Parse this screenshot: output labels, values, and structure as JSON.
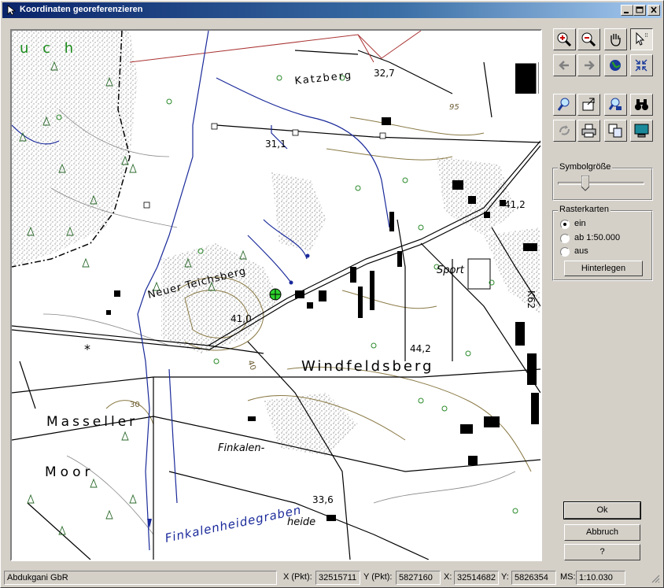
{
  "window": {
    "title": "Koordinaten georeferenzieren"
  },
  "map": {
    "labels": {
      "katzberg": "Katzberg",
      "elev_327": "32,7",
      "elev_311": "31,1",
      "elev_412": "41,2",
      "neuer_teichsberg": "Neuer Teichsberg",
      "elev_410": "41,0",
      "sport": "Sport",
      "elev_442": "44,2",
      "windfeldsberg": "Windfeldsberg",
      "masseller": "Masseller",
      "moor": "Moor",
      "finkalen": "Finkalen-",
      "heide": "heide",
      "elev_336": "33,6",
      "finkalenheidegraben": "Finkalenheidegraben",
      "road_k62": "K62",
      "uch": "u c h",
      "contour_95": "95",
      "contour_30": "30",
      "contour_40": "40"
    }
  },
  "toolbar": {
    "tools": [
      {
        "icon": "zoom-in-icon"
      },
      {
        "icon": "zoom-out-icon"
      },
      {
        "icon": "pan-hand-icon"
      },
      {
        "icon": "pointer-select-icon"
      },
      {
        "icon": "back-arrow-icon"
      },
      {
        "icon": "forward-arrow-icon"
      },
      {
        "icon": "globe-icon"
      },
      {
        "icon": "fit-extent-icon"
      },
      {
        "icon": "zoom-search-icon"
      },
      {
        "icon": "open-map-icon"
      },
      {
        "icon": "find-icon"
      },
      {
        "icon": "binoculars-icon"
      },
      {
        "icon": "refresh-icon"
      },
      {
        "icon": "print-icon"
      },
      {
        "icon": "copy-icon"
      },
      {
        "icon": "monitor-icon"
      }
    ]
  },
  "symbolgroesse": {
    "label": "Symbolgröße",
    "value_fraction": 0.3
  },
  "rasterkarten": {
    "label": "Rasterkarten",
    "options": [
      "ein",
      "ab 1:50.000",
      "aus"
    ],
    "selected": "ein",
    "button": "Hinterlegen"
  },
  "actions": {
    "ok": "Ok",
    "cancel": "Abbruch",
    "help": "?"
  },
  "status": {
    "company": "Abdukgani GbR",
    "x_pkt_label": "X (Pkt):",
    "x_pkt_value": "32515711",
    "y_pkt_label": "Y (Pkt):",
    "y_pkt_value": "5827160",
    "x_label": "X:",
    "x_value": "32514682",
    "y_label": "Y:",
    "y_value": "5826354",
    "ms_label": "MS:",
    "ms_value": "1:10.030"
  }
}
